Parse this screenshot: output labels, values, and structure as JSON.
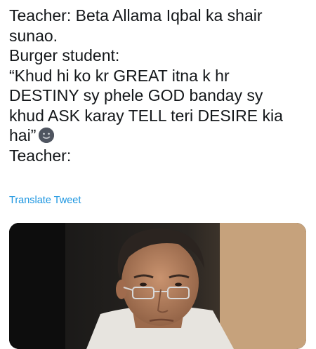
{
  "tweet": {
    "lines": [
      "Teacher: Beta Allama Iqbal ka shair",
      "sunao.",
      "Burger student:",
      "“Khud hi ko kr GREAT itna k hr",
      "DESTINY sy phele GOD banday sy",
      "khud ASK karay TELL teri DESIRE kia",
      "hai”",
      "Teacher:"
    ],
    "emoji": "slightly-smiling-face-icon",
    "translate_label": "Translate Tweet"
  },
  "media": {
    "type": "photo",
    "description_icon": "photo-man-with-glasses"
  },
  "colors": {
    "text": "#14171a",
    "link": "#1b95e0",
    "background": "#ffffff"
  }
}
